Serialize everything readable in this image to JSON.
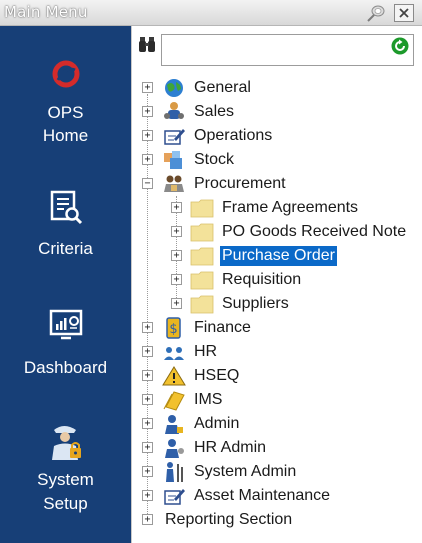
{
  "window": {
    "title": "Main Menu"
  },
  "sidebar": {
    "items": [
      {
        "label_line1": "OPS",
        "label_line2": "Home",
        "icon": "ops-logo-icon"
      },
      {
        "label_line1": "Criteria",
        "label_line2": "",
        "icon": "criteria-icon"
      },
      {
        "label_line1": "Dashboard",
        "label_line2": "",
        "icon": "dashboard-icon"
      },
      {
        "label_line1": "System",
        "label_line2": "Setup",
        "icon": "system-setup-icon"
      }
    ]
  },
  "search": {
    "value": "",
    "placeholder": ""
  },
  "tree": {
    "nodes": [
      {
        "label": "General",
        "expander": "+",
        "icon": "globe-icon"
      },
      {
        "label": "Sales",
        "expander": "+",
        "icon": "sales-people-icon"
      },
      {
        "label": "Operations",
        "expander": "+",
        "icon": "operations-pen-icon"
      },
      {
        "label": "Stock",
        "expander": "+",
        "icon": "stock-boxes-icon"
      },
      {
        "label": "Procurement",
        "expander": "−",
        "icon": "procurement-icon",
        "children": [
          {
            "label": "Frame Agreements",
            "expander": "+",
            "icon": "folder-icon"
          },
          {
            "label": "PO Goods Received Note",
            "expander": "+",
            "icon": "folder-icon"
          },
          {
            "label": "Purchase Order",
            "expander": "+",
            "icon": "folder-icon",
            "selected": true
          },
          {
            "label": "Requisition",
            "expander": "+",
            "icon": "folder-icon"
          },
          {
            "label": "Suppliers",
            "expander": "+",
            "icon": "folder-icon"
          }
        ]
      },
      {
        "label": "Finance",
        "expander": "+",
        "icon": "finance-dollar-icon"
      },
      {
        "label": "HR",
        "expander": "+",
        "icon": "hr-people-icon"
      },
      {
        "label": "HSEQ",
        "expander": "+",
        "icon": "warning-triangle-icon"
      },
      {
        "label": "IMS",
        "expander": "+",
        "icon": "ims-notes-icon"
      },
      {
        "label": "Admin",
        "expander": "+",
        "icon": "admin-person-icon"
      },
      {
        "label": "HR Admin",
        "expander": "+",
        "icon": "hr-admin-icon"
      },
      {
        "label": "System Admin",
        "expander": "+",
        "icon": "system-admin-icon"
      },
      {
        "label": "Asset Maintenance",
        "expander": "+",
        "icon": "asset-maintenance-icon"
      },
      {
        "label": "Reporting Section",
        "expander": "+",
        "icon": ""
      }
    ]
  },
  "colors": {
    "sidebar": "#173f77",
    "selection": "#0b69c8",
    "accent_red": "#d42b2b",
    "folder": "#f3e29a"
  }
}
